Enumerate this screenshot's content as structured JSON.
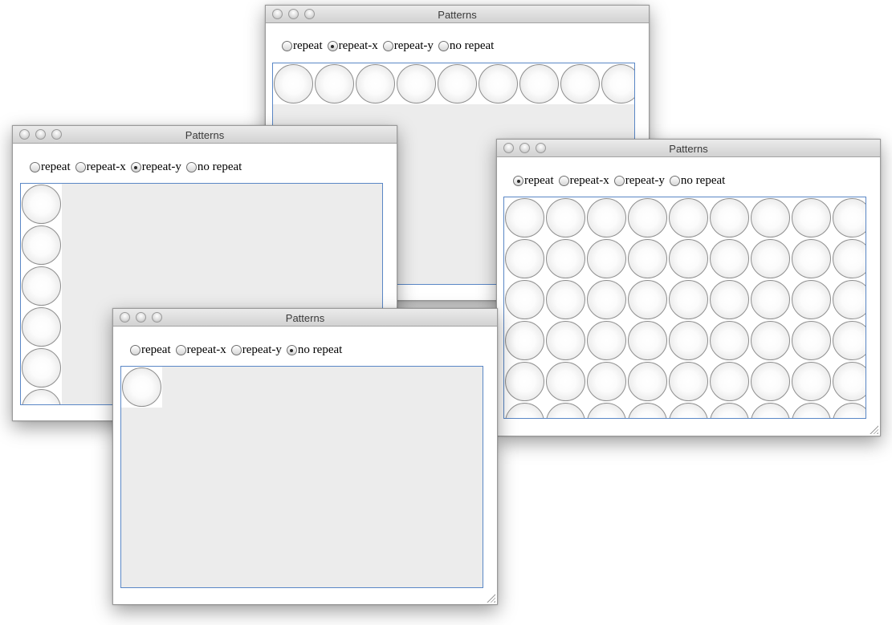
{
  "windows": [
    {
      "id": "repeat-x",
      "title": "Patterns",
      "options": [
        "repeat",
        "repeat-x",
        "repeat-y",
        "no repeat"
      ],
      "selected": "repeat-x",
      "pattern_mode": "repeat-x",
      "has_resize_grip": false
    },
    {
      "id": "repeat-y",
      "title": "Patterns",
      "options": [
        "repeat",
        "repeat-x",
        "repeat-y",
        "no repeat"
      ],
      "selected": "repeat-y",
      "pattern_mode": "repeat-y",
      "has_resize_grip": false
    },
    {
      "id": "repeat",
      "title": "Patterns",
      "options": [
        "repeat",
        "repeat-x",
        "repeat-y",
        "no repeat"
      ],
      "selected": "repeat",
      "pattern_mode": "repeat",
      "has_resize_grip": true
    },
    {
      "id": "no-repeat",
      "title": "Patterns",
      "options": [
        "repeat",
        "repeat-x",
        "repeat-y",
        "no repeat"
      ],
      "selected": "no repeat",
      "pattern_mode": "no repeat",
      "has_resize_grip": true
    }
  ],
  "icons": {
    "window_controls": [
      "close-icon",
      "minimize-icon",
      "zoom-icon"
    ],
    "pattern_tile": "circle-pattern-tile",
    "resize": "resize-grip-icon"
  },
  "colors": {
    "panel_border": "#5a87c6",
    "panel_background": "#ececec",
    "tile_background": "#ffffff"
  }
}
